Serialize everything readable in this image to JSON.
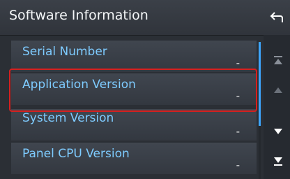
{
  "header": {
    "title": "Software Information",
    "back_icon": "back-arrow-icon"
  },
  "list": {
    "items": [
      {
        "label": "Serial Number",
        "value": "-"
      },
      {
        "label": "Application Version",
        "value": "-",
        "selected": true
      },
      {
        "label": "System Version",
        "value": "-"
      },
      {
        "label": "Panel CPU Version",
        "value": "-"
      }
    ]
  },
  "side_controls": {
    "icons": [
      "scroll-to-top-icon",
      "scroll-up-icon",
      "scroll-down-icon",
      "scroll-to-bottom-icon"
    ]
  },
  "colors": {
    "accent": "#7ecbff",
    "highlight": "#d6201f",
    "scroll_thumb": "#3ea6ff"
  }
}
